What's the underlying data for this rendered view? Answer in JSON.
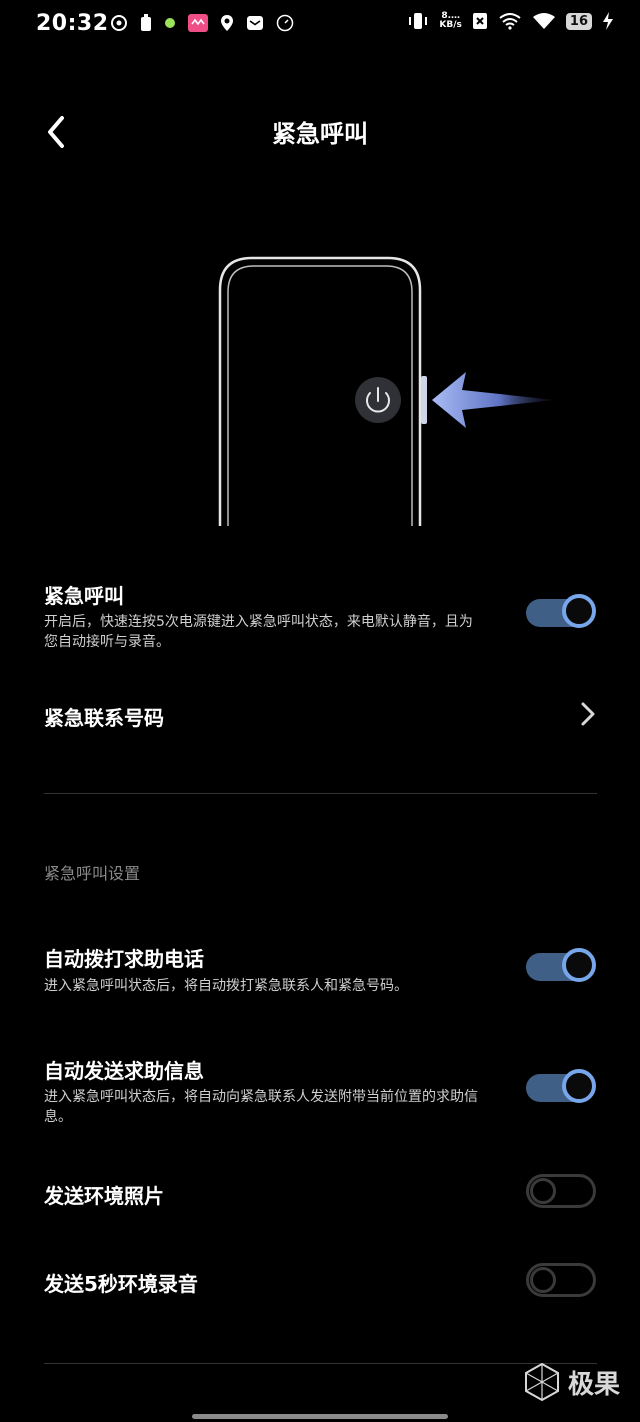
{
  "status_bar": {
    "time": "20:32",
    "net_speed_value": "8.…",
    "net_speed_unit": "KB/s",
    "battery": "16"
  },
  "header": {
    "title": "紧急呼叫"
  },
  "emergency_call": {
    "title": "紧急呼叫",
    "description": "开启后，快速连按5次电源键进入紧急呼叫状态，来电默认静音，且为您自动接听与录音。",
    "enabled": true
  },
  "emergency_contacts": {
    "title": "紧急联系号码"
  },
  "settings_section": {
    "label": "紧急呼叫设置",
    "items": [
      {
        "title": "自动拨打求助电话",
        "description": "进入紧急呼叫状态后，将自动拨打紧急联系人和紧急号码。",
        "enabled": true
      },
      {
        "title": "自动发送求助信息",
        "description": "进入紧急呼叫状态后，将自动向紧急联系人发送附带当前位置的求助信息。",
        "enabled": true
      },
      {
        "title": "发送环境照片",
        "description": "",
        "enabled": false
      },
      {
        "title": "发送5秒环境录音",
        "description": "",
        "enabled": false
      }
    ]
  },
  "watermark": {
    "text": "极果"
  },
  "colors": {
    "background": "#000000",
    "toggle_on_track": "#3f5f86",
    "toggle_on_knob": "#78a6ea",
    "toggle_off": "#3a3a3a",
    "arrow_accent": "#9fb4f0"
  }
}
